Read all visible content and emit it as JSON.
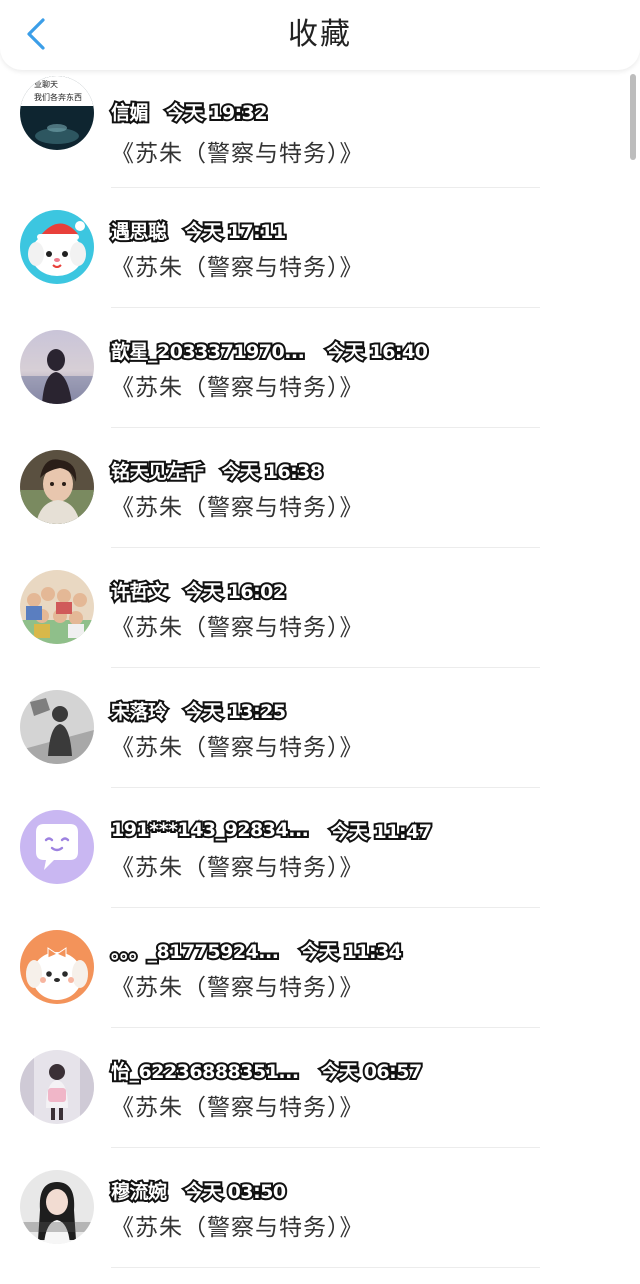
{
  "header": {
    "title": "收藏",
    "back_icon": "chevron-left-icon",
    "accent_color": "#3b9ee8"
  },
  "avatar_caption": [
    "业聊天",
    "我们各奔东西"
  ],
  "favorites": [
    {
      "name": "信媚",
      "time": "今天 19:32",
      "message": "《苏朱（警察与特务）》",
      "avatar": "night-sky-text"
    },
    {
      "name": "遇思聪",
      "time": "今天 17:11",
      "message": "《苏朱（警察与特务）》",
      "avatar": "cartoon-puppy-santa-hat"
    },
    {
      "name": "歆星_2033371970...",
      "time": "今天 16:40",
      "message": "《苏朱（警察与特务）》",
      "avatar": "girl-at-beach"
    },
    {
      "name": "铭天见左千",
      "time": "今天 16:38",
      "message": "《苏朱（警察与特务）》",
      "avatar": "young-man-portrait"
    },
    {
      "name": "许哲文",
      "time": "今天 16:02",
      "message": "《苏朱（警察与特务）》",
      "avatar": "group-photo"
    },
    {
      "name": "宋落玲",
      "time": "今天 13:25",
      "message": "《苏朱（警察与特务）》",
      "avatar": "monochrome-figure"
    },
    {
      "name": "191***143_92834...",
      "time": "今天 11:47",
      "message": "《苏朱（警察与特务）》",
      "avatar": "purple-chat-bubble"
    },
    {
      "name": "。。。_81775924...",
      "time": "今天 11:34",
      "message": "《苏朱（警察与特务）》",
      "avatar": "cartoon-dog-bow"
    },
    {
      "name": "怡_62236888351...",
      "time": "今天 06:57",
      "message": "《苏朱（警察与特务）》",
      "avatar": "girl-with-backpack"
    },
    {
      "name": "穆流婉",
      "time": "今天 03:50",
      "message": "《苏朱（警察与特务）》",
      "avatar": "girl-portrait"
    }
  ]
}
